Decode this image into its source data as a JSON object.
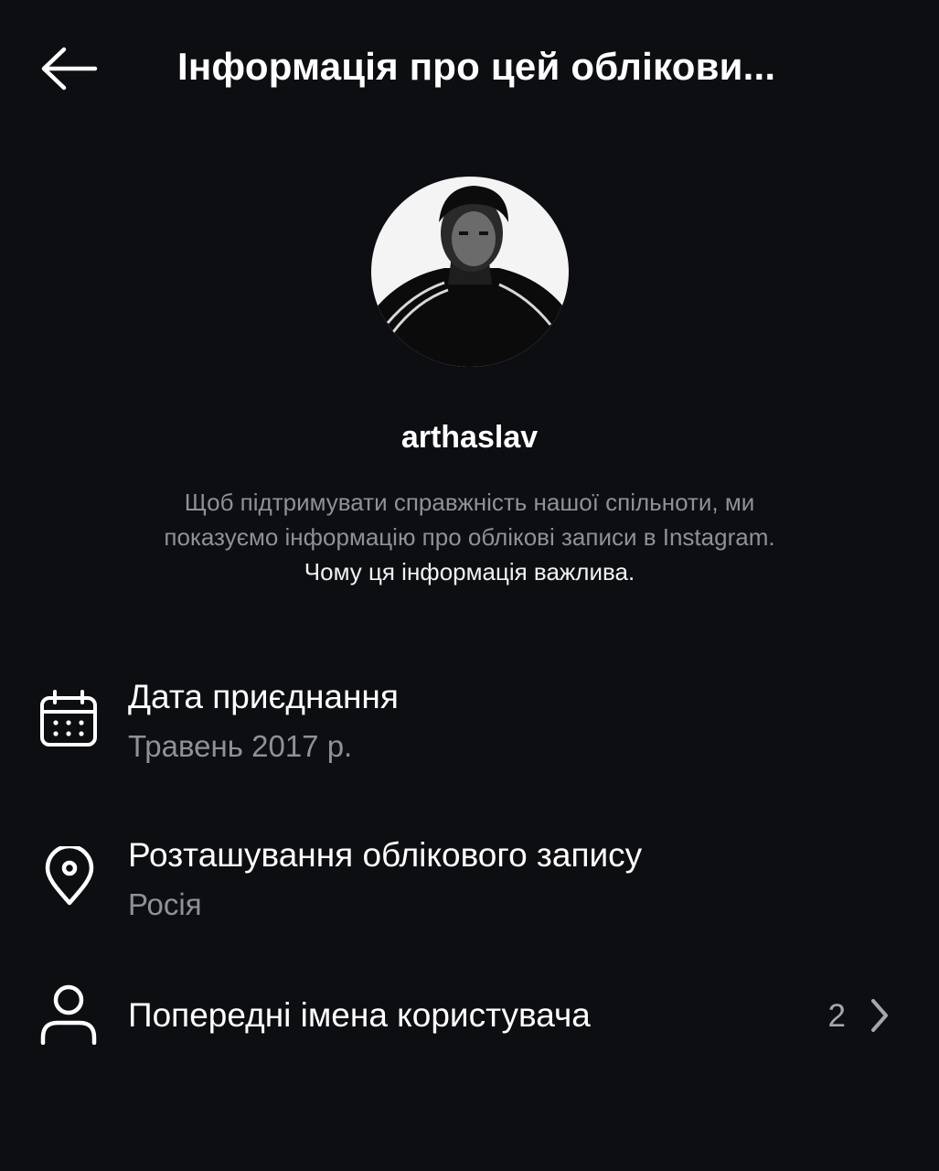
{
  "header": {
    "back_icon": "arrow-left-icon",
    "title": "Інформація про цей облікови..."
  },
  "profile": {
    "avatar": "profile-photo",
    "username": "arthaslav",
    "description_line1": "Щоб підтримувати справжність нашої спільноти, ми",
    "description_line2": "показуємо інформацію про облікові записи в Instagram.",
    "link_text": "Чому ця інформація важлива."
  },
  "rows": {
    "join_date": {
      "icon": "calendar-icon",
      "title": "Дата приєднання",
      "value": "Травень 2017 р."
    },
    "location": {
      "icon": "location-pin-icon",
      "title": "Розташування облікового запису",
      "value": "Росія"
    },
    "former_usernames": {
      "icon": "person-icon",
      "title": "Попередні імена користувача",
      "count": "2",
      "chevron_icon": "chevron-right-icon"
    }
  },
  "colors": {
    "background": "#0d0e12",
    "primary_text": "#ffffff",
    "secondary_text": "#8e9199"
  }
}
